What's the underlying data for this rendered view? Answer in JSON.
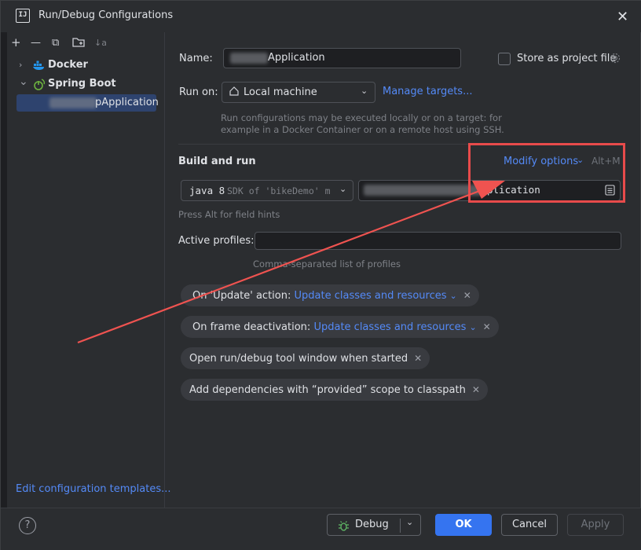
{
  "window": {
    "app_icon_text": "IJ",
    "title": "Run/Debug Configurations",
    "close_glyph": "✕"
  },
  "toolbar": {
    "icons": [
      "add-icon",
      "remove-icon",
      "copy-icon",
      "folder-add-icon",
      "sort-icon"
    ],
    "glyphs": [
      "+",
      "—",
      "⧉",
      "🗀",
      "↓a"
    ]
  },
  "tree": {
    "docker_label": "Docker",
    "spring_boot_label": "Spring Boot",
    "selected_config_visible": "pApplication",
    "chevron_right": "›",
    "chevron_down": "⌄"
  },
  "left_footer": {
    "edit_templates_link": "Edit configuration templates..."
  },
  "form": {
    "name_label": "Name:",
    "name_value_visible": "Application",
    "store_as_project_file_label": "Store as project file",
    "run_on_label": "Run on:",
    "run_on_value": "Local machine",
    "manage_targets_link": "Manage targets...",
    "run_on_hint_line1": "Run configurations may be executed locally or on a target: for",
    "run_on_hint_line2": "example in a Docker Container or on a remote host using SSH.",
    "build_and_run_title": "Build and run",
    "modify_options_link": "Modify options",
    "modify_options_shortcut": "Alt+M",
    "jdk_value": "java 8",
    "jdk_hint": "SDK of 'bikeDemo' m",
    "main_class_visible": "plication",
    "field_hints": "Press Alt for field hints",
    "active_profiles_label": "Active profiles:",
    "active_profiles_value": "",
    "active_profiles_hint": "Comma-separated list of profiles"
  },
  "chips": [
    {
      "prefix": "On 'Update' action:",
      "value": "Update classes and resources"
    },
    {
      "prefix": "On frame deactivation:",
      "value": "Update classes and resources"
    },
    {
      "prefix": "Open run/debug tool window when started",
      "value": ""
    },
    {
      "prefix": "Add dependencies with “provided” scope to classpath",
      "value": ""
    }
  ],
  "footer": {
    "help_glyph": "?",
    "debug_button": "Debug",
    "ok_button": "OK",
    "cancel_button": "Cancel",
    "apply_button": "Apply"
  },
  "colors": {
    "accent": "#3574f0",
    "link": "#548af7",
    "highlight_box": "#e84b4b",
    "annotation_arrow": "#ef5350"
  }
}
